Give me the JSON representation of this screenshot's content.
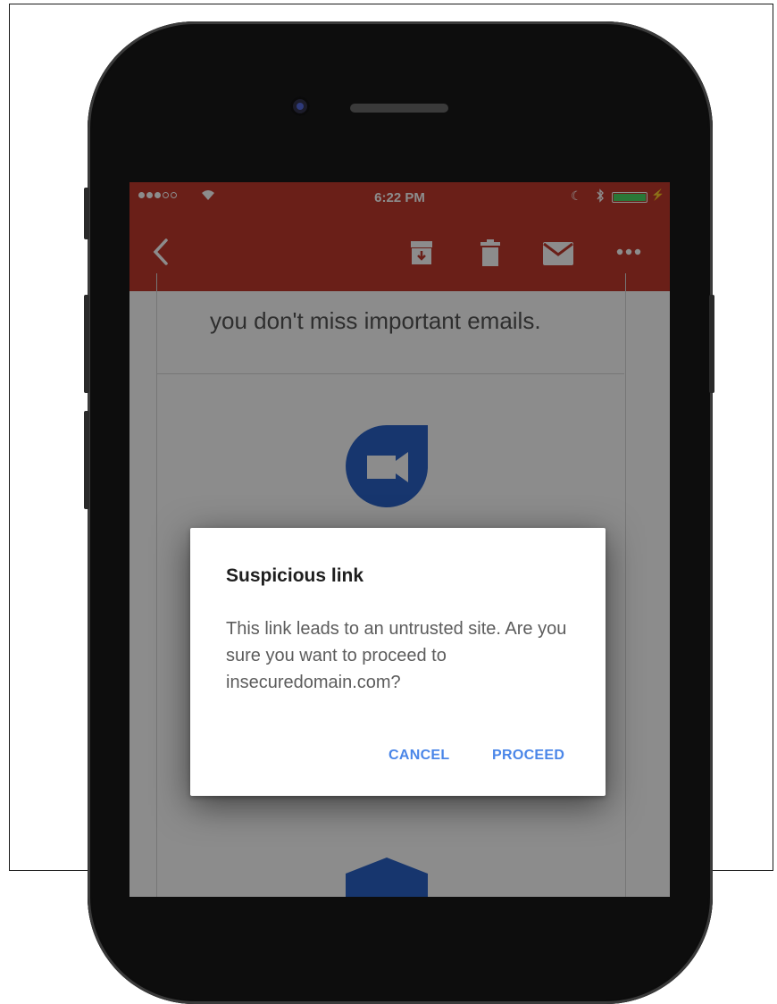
{
  "status_bar": {
    "time": "6:22 PM"
  },
  "app_bar": {
    "icons": [
      "back-icon",
      "archive-icon",
      "trash-icon",
      "mail-icon",
      "more-icon"
    ]
  },
  "email": {
    "body_line": "you don't miss important emails."
  },
  "dialog": {
    "title": "Suspicious link",
    "message": "This link leads to an untrusted site. Are you sure you want to proceed to insecuredomain.com?",
    "cancel_label": "CANCEL",
    "proceed_label": "PROCEED"
  },
  "colors": {
    "app_bar": "#c23a2d",
    "accent_button": "#4a86e8",
    "duo_logo": "#2a63c9"
  }
}
